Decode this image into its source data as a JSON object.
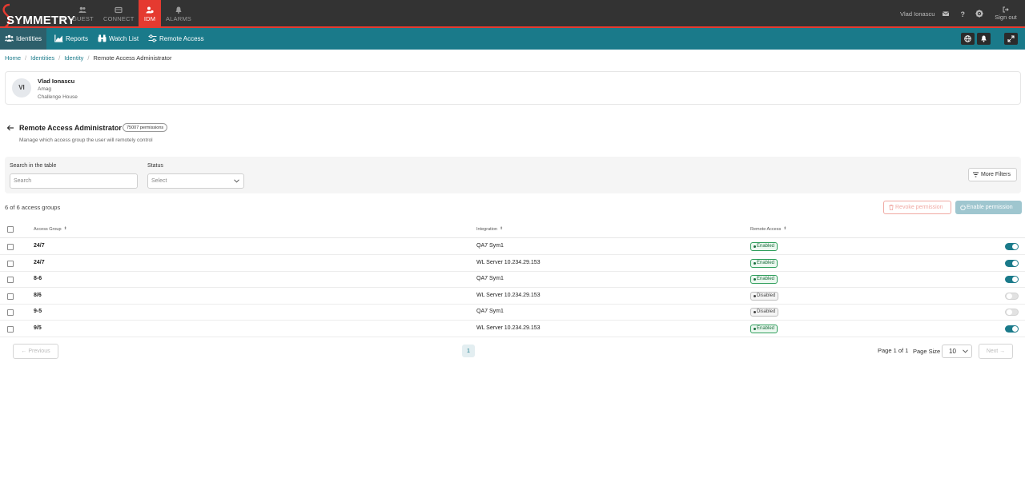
{
  "brand": {
    "name": "SYMMETRY",
    "tm": "™",
    "accent": "#e53a30",
    "teal": "#1a7a8a"
  },
  "topnav": [
    {
      "label": "GUEST",
      "icon": "users-icon"
    },
    {
      "label": "CONNECT",
      "icon": "connect-icon"
    },
    {
      "label": "IDM",
      "icon": "idm-icon",
      "active": true
    },
    {
      "label": "ALARMS",
      "icon": "bell-icon"
    }
  ],
  "topright": {
    "user": "Vlad Ionascu",
    "signout": "Sign out"
  },
  "subnav": [
    {
      "label": "Identities",
      "icon": "identities-icon",
      "active": true
    },
    {
      "label": "Reports",
      "icon": "reports-icon"
    },
    {
      "label": "Watch List",
      "icon": "binoculars-icon"
    },
    {
      "label": "Remote Access",
      "icon": "sliders-icon"
    }
  ],
  "breadcrumb": [
    "Home",
    "Identities",
    "Identity",
    "Remote Access Administrator"
  ],
  "identity": {
    "initials": "VI",
    "name": "Vlad Ionascu",
    "company": "Amag",
    "site": "Challenge House"
  },
  "page": {
    "title": "Remote Access Administrator",
    "badge": "75007 permissions",
    "subtitle": "Manage which access group the user will remotely control"
  },
  "filters": {
    "search_label": "Search in the table",
    "search_placeholder": "Search",
    "status_label": "Status",
    "status_placeholder": "Select",
    "more_filters": "More Filters"
  },
  "summary": {
    "count": "6 of 6 access groups",
    "revoke": "Revoke permission",
    "enable": "Enable permission"
  },
  "table": {
    "headers": [
      "Access Group",
      "Integration",
      "Remote Access"
    ],
    "rows": [
      {
        "group": "24/7",
        "integration": "QA7 Sym1",
        "status": "Enabled",
        "enabled": true
      },
      {
        "group": "24/7",
        "integration": "WL Server 10.234.29.153",
        "status": "Enabled",
        "enabled": true
      },
      {
        "group": "8-6",
        "integration": "QA7 Sym1",
        "status": "Enabled",
        "enabled": true
      },
      {
        "group": "8/6",
        "integration": "WL Server 10.234.29.153",
        "status": "Disabled",
        "enabled": false
      },
      {
        "group": "9-5",
        "integration": "QA7 Sym1",
        "status": "Disabled",
        "enabled": false
      },
      {
        "group": "9/5",
        "integration": "WL Server 10.234.29.153",
        "status": "Enabled",
        "enabled": true
      }
    ]
  },
  "pagination": {
    "previous": "Previous",
    "next": "Next",
    "current": "1",
    "info": "Page 1 of 1",
    "size_label": "Page Size",
    "size": "10"
  }
}
